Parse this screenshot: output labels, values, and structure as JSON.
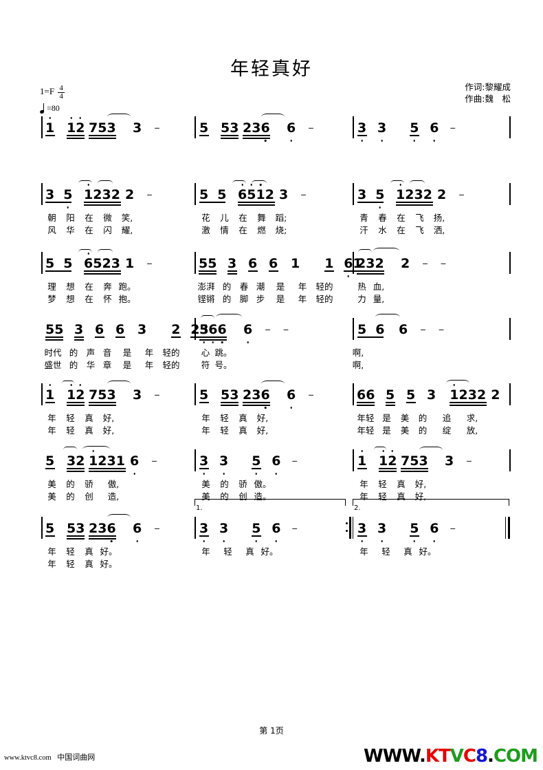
{
  "sheet": {
    "title": "年轻真好",
    "key_signature": "1=F",
    "time_signature_top": "4",
    "time_signature_bottom": "4",
    "tempo": "=80",
    "lyricist": "作词:黎耀成",
    "composer": "作曲:魏　松",
    "page_label": "第 1页"
  },
  "footer": {
    "site_url": "www.ktvc8.com",
    "site_name": "中国词曲网",
    "logo_text": "WWW.KTVC8.COM"
  },
  "systems": [
    {
      "id": "system-1",
      "measures": [
        {
          "id": "m1",
          "notes": "1̇ 1̇2̇ 753 3 —",
          "lyrics_line1": "",
          "lyrics_line2": ""
        },
        {
          "id": "m2",
          "notes": "5 53 236̣ 6̣ —",
          "lyrics_line1": "",
          "lyrics_line2": ""
        },
        {
          "id": "m3",
          "notes": "3̣ 3̣ 5̣ 6̣ —",
          "lyrics_line1": "",
          "lyrics_line2": ""
        }
      ]
    },
    {
      "id": "system-2",
      "measures": [
        {
          "id": "m4",
          "notes": "3 5̣ 1̇232 2 —",
          "lyrics_line1": "朝 阳 在 微 笑,",
          "lyrics_line2": "风 华 在 闪 耀,"
        },
        {
          "id": "m5",
          "notes": "5 5 6̇5̇1̇2 3 —",
          "lyrics_line1": "花 儿 在 舞 蹈;",
          "lyrics_line2": "激 情 在 燃 烧;"
        },
        {
          "id": "m6",
          "notes": "3 5̣ 1̇232 2 —",
          "lyrics_line1": "青 春 在 飞 扬,",
          "lyrics_line2": "汗 水 在 飞 洒,"
        }
      ]
    },
    {
      "id": "system-3",
      "measures": [
        {
          "id": "m7",
          "notes": "5 5 6̇523 1 —",
          "lyrics_line1": "理 想 在 奔 跑。",
          "lyrics_line2": "梦 想 在 怀 抱。"
        },
        {
          "id": "m8",
          "notes": "55 3 6 6 1 1 6̣1",
          "lyrics_line1": "澎湃 的 春 潮 是 年 轻的",
          "lyrics_line2": "铿锵 的 脚 步 是 年 轻的"
        },
        {
          "id": "m9",
          "notes": "232 2 — —",
          "lyrics_line1": "热 血,",
          "lyrics_line2": "力 量,"
        }
      ]
    },
    {
      "id": "system-4",
      "measures": [
        {
          "id": "m10",
          "notes": "55 3 6 6 3 2 23",
          "lyrics_line1": "时代 的 声 音 是 年 轻的",
          "lyrics_line2": "盛世 的 华 章 是 年 轻的"
        },
        {
          "id": "m11",
          "notes": "5̣6̣6̣ 6̣ — —",
          "lyrics_line1": "心 跳。",
          "lyrics_line2": "符 号。"
        },
        {
          "id": "m12",
          "notes": "5 6 6 — —",
          "lyrics_line1": "啊,",
          "lyrics_line2": "啊,"
        }
      ]
    },
    {
      "id": "system-5",
      "measures": [
        {
          "id": "m13",
          "notes": "1̇ 1̇2̇ 753 3 —",
          "lyrics_line1": "年 轻 真 好,",
          "lyrics_line2": "年 轻 真 好,"
        },
        {
          "id": "m14",
          "notes": "5 53 236̣ 6̣ —",
          "lyrics_line1": "年 轻 真 好,",
          "lyrics_line2": "年 轻 真 好,"
        },
        {
          "id": "m15",
          "notes": "66 5 5 3 1̇232 2",
          "lyrics_line1": "年轻 是 美 的 追 求,",
          "lyrics_line2": "年轻 是 美 的 绽 放,"
        }
      ]
    },
    {
      "id": "system-6",
      "measures": [
        {
          "id": "m16",
          "notes": "5 32 1̇231 6̣ —",
          "lyrics_line1": "美 的 骄 傲,",
          "lyrics_line2": "美 的 创 造,"
        },
        {
          "id": "m17",
          "notes": "3̣ 3̣ 5̣ 6̣ —",
          "lyrics_line1": "美 的 骄 傲。",
          "lyrics_line2": "美 的 创 造。"
        },
        {
          "id": "m18",
          "notes": "1̇ 1̇2̇ 753 3 —",
          "lyrics_line1": "年 轻 真 好,",
          "lyrics_line2": "年 轻 真 好,"
        }
      ]
    },
    {
      "id": "system-7",
      "measures": [
        {
          "id": "m19",
          "notes": "5 53 236̣ 6̣ —",
          "lyrics_line1": "年 轻 真 好。",
          "lyrics_line2": "年 轻 真 好。"
        },
        {
          "id": "m20",
          "notes": "3̣ 3̣ 5̣ 6̣ —",
          "lyrics_line1": "年 轻 真 好。",
          "lyrics_line2": ""
        },
        {
          "id": "m21",
          "notes": "3̣ 3̣ 5̣ 6̣ —",
          "lyrics_line1": "年 轻 真 好。",
          "lyrics_line2": ""
        }
      ]
    }
  ],
  "voltas": {
    "first": "1.",
    "second": "2."
  },
  "syllables": {
    "s2a1": [
      "朝",
      "阳",
      "在",
      "微",
      "笑,"
    ],
    "s2a2": [
      "风",
      "华",
      "在",
      "闪",
      "耀,"
    ],
    "s2b1": [
      "花",
      "儿",
      "在",
      "舞",
      "蹈;"
    ],
    "s2b2": [
      "激",
      "情",
      "在",
      "燃",
      "烧;"
    ],
    "s2c1": [
      "青",
      "春",
      "在",
      "飞",
      "扬,"
    ],
    "s2c2": [
      "汗",
      "水",
      "在",
      "飞",
      "洒,"
    ],
    "s3a1": [
      "理",
      "想",
      "在",
      "奔",
      "跑。"
    ],
    "s3a2": [
      "梦",
      "想",
      "在",
      "怀",
      "抱。"
    ],
    "s3b1": [
      "澎湃",
      "的",
      "春",
      "潮",
      "是",
      "年",
      "轻的"
    ],
    "s3b2": [
      "铿锵",
      "的",
      "脚",
      "步",
      "是",
      "年",
      "轻的"
    ],
    "s3c1": [
      "热",
      "血,"
    ],
    "s3c2": [
      "力",
      "量,"
    ],
    "s4a1": [
      "时代",
      "的",
      "声",
      "音",
      "是",
      "年",
      "轻的"
    ],
    "s4a2": [
      "盛世",
      "的",
      "华",
      "章",
      "是",
      "年",
      "轻的"
    ],
    "s4b1": [
      "心",
      "跳。"
    ],
    "s4b2": [
      "符",
      "号。"
    ],
    "s4c1": [
      "啊,"
    ],
    "s4c2": [
      "啊,"
    ],
    "s5a1": [
      "年",
      "轻",
      "真",
      "好,"
    ],
    "s5a2": [
      "年",
      "轻",
      "真",
      "好,"
    ],
    "s5b1": [
      "年",
      "轻",
      "真",
      "好,"
    ],
    "s5b2": [
      "年",
      "轻",
      "真",
      "好,"
    ],
    "s5c1": [
      "年轻",
      "是",
      "美",
      "的",
      "追",
      "求,"
    ],
    "s5c2": [
      "年轻",
      "是",
      "美",
      "的",
      "绽",
      "放,"
    ],
    "s6a1": [
      "美",
      "的",
      "骄",
      "傲,"
    ],
    "s6a2": [
      "美",
      "的",
      "创",
      "造,"
    ],
    "s6b1": [
      "美",
      "的",
      "骄",
      "傲。"
    ],
    "s6b2": [
      "美",
      "的",
      "创",
      "造。"
    ],
    "s6c1": [
      "年",
      "轻",
      "真",
      "好,"
    ],
    "s6c2": [
      "年",
      "轻",
      "真",
      "好,"
    ],
    "s7a1": [
      "年",
      "轻",
      "真",
      "好。"
    ],
    "s7a2": [
      "年",
      "轻",
      "真",
      "好。"
    ],
    "s7b1": [
      "年",
      "轻",
      "真",
      "好。"
    ],
    "s7c1": [
      "年",
      "轻",
      "真",
      "好。"
    ]
  }
}
